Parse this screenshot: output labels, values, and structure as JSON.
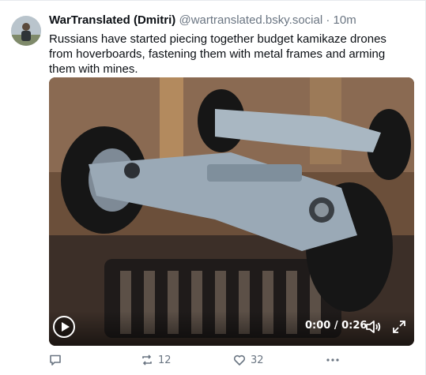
{
  "post": {
    "display_name": "WarTranslated (Dmitri)",
    "handle": "@wartranslated.bsky.social",
    "separator": "·",
    "time": "10m",
    "text": "Russians have started piecing together budget kamikaze drones from hoverboards, fastening them with metal frames and arming them with mines."
  },
  "video": {
    "timecode": "0:00 / 0:26"
  },
  "actions": {
    "reply_count": "",
    "repost_count": "12",
    "like_count": "32"
  },
  "icons": {
    "reply": "reply-icon",
    "repost": "repost-icon",
    "like": "heart-icon",
    "more": "more-icon",
    "play": "play-icon",
    "volume": "volume-icon",
    "fullscreen": "fullscreen-icon"
  },
  "colors": {
    "text": "#0b0f14",
    "muted": "#6a7582"
  }
}
